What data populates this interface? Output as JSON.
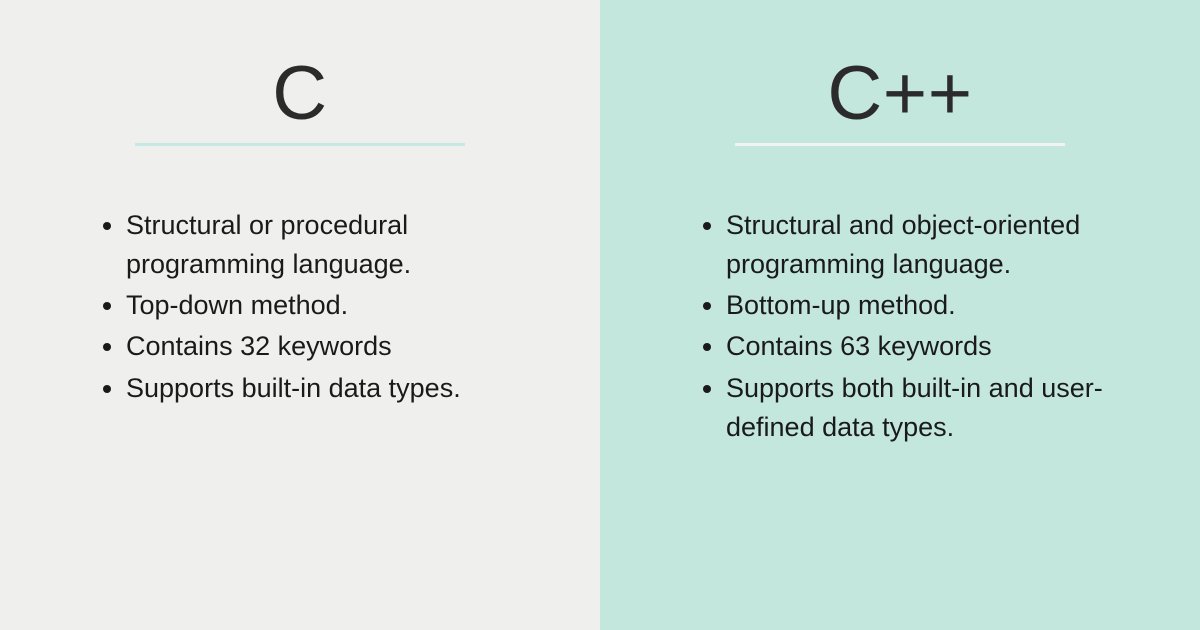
{
  "left": {
    "title": "C",
    "points": [
      "Structural or procedural programming language.",
      "Top-down method.",
      "Contains 32 keywords",
      "Supports built-in data types."
    ]
  },
  "right": {
    "title": "C++",
    "points": [
      "Structural and object-oriented programming language.",
      "Bottom-up method.",
      "Contains 63 keywords",
      "Supports both built-in and user-defined data types."
    ]
  },
  "colors": {
    "left_bg": "#efefed",
    "right_bg": "#c3e6dd",
    "left_underline": "#c6e9e6",
    "right_underline": "#f1f3f2"
  }
}
